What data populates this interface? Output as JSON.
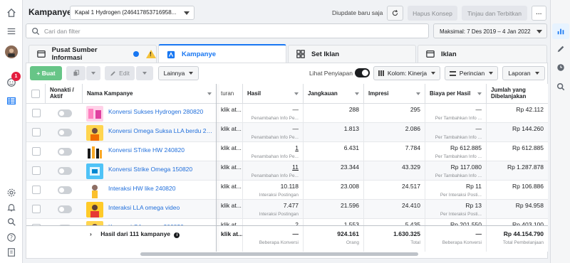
{
  "header": {
    "title": "Kampanye",
    "campaign_select": "Kapal 1 Hydrogen (246417853716958...",
    "updated": "Diupdate baru saja",
    "hapus_label": "Hapus Konsep",
    "tinjau_label": "Tinjau dan Terbitkan",
    "more_label": "···"
  },
  "search": {
    "placeholder": "Cari dan filter"
  },
  "date_range": "Maksimal: 7 Des 2019 – 4 Jan 2022",
  "notification_badge": "1",
  "tabs": [
    {
      "label": "Pusat Sumber Informasi",
      "icon": "dashboard-icon"
    },
    {
      "label": "Kampanye",
      "icon": "folder-icon"
    },
    {
      "label": "Set Iklan",
      "icon": "grid-icon"
    },
    {
      "label": "Iklan",
      "icon": "ad-icon"
    }
  ],
  "toolbar": {
    "create_label": "+ Buat",
    "edit_label": "Edit",
    "more_label": "Lainnya",
    "preview_label": "Lihat Penyiapan",
    "columns_label": "Kolom: Kinerja",
    "breakdown_label": "Perincian",
    "reports_label": "Laporan"
  },
  "columns": {
    "toggle": "Nonakti / Aktif",
    "name": "Nama Kampanye",
    "type": "turan",
    "results": "Hasil",
    "reach": "Jangkauan",
    "impressions": "Impresi",
    "cost_per_result": "Biaya per Hasil",
    "amount_spent": "Jumlah yang Dibelanjakan"
  },
  "rows": [
    {
      "name": "Konversi Sukses Hydrogen 280820",
      "type": "klik at...",
      "result": "—",
      "result_sub": "Penambahan Info Pe...",
      "reach": "288",
      "impr": "295",
      "cpr": "—",
      "cpr_sub": "Per Tambahkan Info ...",
      "spent": "Rp 42.112"
    },
    {
      "name": "Konversi Omega Suksa LLA berdu 270...",
      "type": "klik at...",
      "result": "—",
      "result_sub": "Penambahan Info Pe...",
      "reach": "1.813",
      "impr": "2.086",
      "cpr": "—",
      "cpr_sub": "Per Tambahkan Info ...",
      "spent": "Rp 144.260"
    },
    {
      "name": "Konversi STrike HW 240820",
      "type": "klik at...",
      "result": "1",
      "result_sub": "Penambahan Info Pe...",
      "reach": "6.431",
      "impr": "7.784",
      "cpr": "Rp 612.885",
      "cpr_sub": "Per Tambahkan Info ...",
      "spent": "Rp 612.885"
    },
    {
      "name": "Konversi Strike Omega 150820",
      "type": "klik at...",
      "result": "11",
      "result_sub": "Penambahan Info Pe...",
      "reach": "23.344",
      "impr": "43.329",
      "cpr": "Rp 117.080",
      "cpr_sub": "Per Tambahkan Info ...",
      "spent": "Rp 1.287.878"
    },
    {
      "name": "Interaksi HW like 240820",
      "type": "klik at...",
      "result": "10.118",
      "result_sub": "Interaksi Postingan",
      "reach": "23.008",
      "impr": "24.517",
      "cpr": "Rp 11",
      "cpr_sub": "Per Interaksi Posti...",
      "spent": "Rp 106.886"
    },
    {
      "name": "Interaksi LLA omega video",
      "type": "klik at...",
      "result": "7.477",
      "result_sub": "Interaksi Postingan",
      "reach": "21.596",
      "impr": "24.410",
      "cpr": "Rp 13",
      "cpr_sub": "Per Interaksi Posti...",
      "spent": "Rp 94.958"
    },
    {
      "name": "Konversi CA omega 200820",
      "type": "klik at...",
      "result": "2",
      "result_sub": "",
      "reach": "1.553",
      "impr": "5.435",
      "cpr": "Rp 201.550",
      "cpr_sub": "",
      "spent": "Rp 403.100"
    }
  ],
  "footer": {
    "label": "Hasil dari 111 kampanye",
    "type": "klik at...",
    "result": "—",
    "result_sub": "Beberapa Konversi",
    "reach": "924.161",
    "reach_sub": "Orang",
    "impr": "1.630.325",
    "impr_sub": "Total",
    "cpr": "—",
    "cpr_sub": "Beberapa Konversi",
    "spent": "Rp 44.154.790",
    "spent_sub": "Total Pembelanjaan"
  },
  "colors": {
    "accent": "#1877f2",
    "create_button": "#67c587",
    "link": "#216fdb",
    "badge": "#e41e3f"
  }
}
